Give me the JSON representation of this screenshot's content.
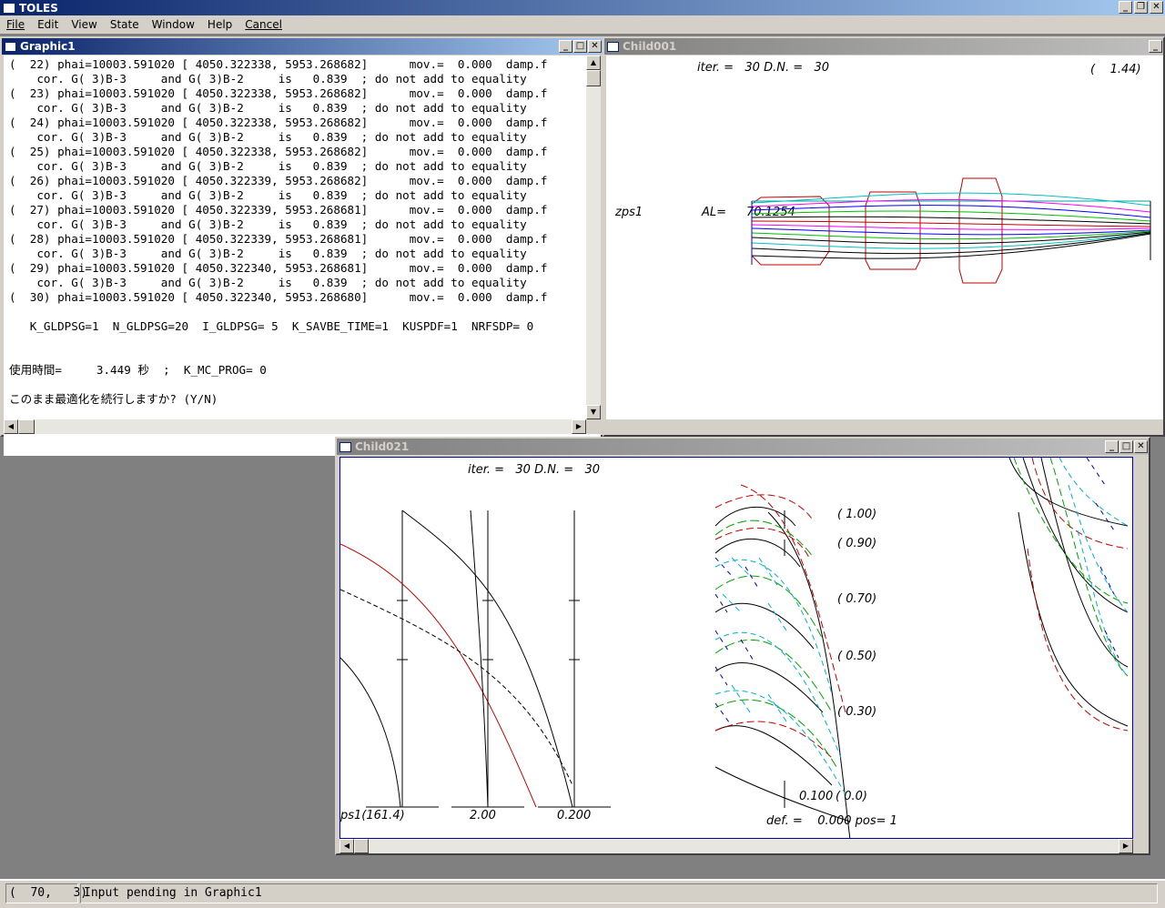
{
  "app": {
    "title": "TOLES"
  },
  "menu": {
    "file": "File",
    "edit": "Edit",
    "view": "View",
    "state": "State",
    "window": "Window",
    "help": "Help",
    "cancel": "Cancel"
  },
  "graphic1": {
    "title": "Graphic1",
    "lines": [
      "(  22) phai=10003.591020 [ 4050.322338, 5953.268682]      mov.=  0.000  damp.f",
      "    cor. G( 3)B-3     and G( 3)B-2     is   0.839  ; do not add to equality",
      "(  23) phai=10003.591020 [ 4050.322338, 5953.268682]      mov.=  0.000  damp.f",
      "    cor. G( 3)B-3     and G( 3)B-2     is   0.839  ; do not add to equality",
      "(  24) phai=10003.591020 [ 4050.322338, 5953.268682]      mov.=  0.000  damp.f",
      "    cor. G( 3)B-3     and G( 3)B-2     is   0.839  ; do not add to equality",
      "(  25) phai=10003.591020 [ 4050.322338, 5953.268682]      mov.=  0.000  damp.f",
      "    cor. G( 3)B-3     and G( 3)B-2     is   0.839  ; do not add to equality",
      "(  26) phai=10003.591020 [ 4050.322339, 5953.268682]      mov.=  0.000  damp.f",
      "    cor. G( 3)B-3     and G( 3)B-2     is   0.839  ; do not add to equality",
      "(  27) phai=10003.591020 [ 4050.322339, 5953.268681]      mov.=  0.000  damp.f",
      "    cor. G( 3)B-3     and G( 3)B-2     is   0.839  ; do not add to equality",
      "(  28) phai=10003.591020 [ 4050.322339, 5953.268681]      mov.=  0.000  damp.f",
      "    cor. G( 3)B-3     and G( 3)B-2     is   0.839  ; do not add to equality",
      "(  29) phai=10003.591020 [ 4050.322340, 5953.268681]      mov.=  0.000  damp.f",
      "    cor. G( 3)B-3     and G( 3)B-2     is   0.839  ; do not add to equality",
      "(  30) phai=10003.591020 [ 4050.322340, 5953.268680]      mov.=  0.000  damp.f",
      "",
      "   K_GLDPSG=1  N_GLDPSG=20  I_GLDPSG= 5  K_SAVBE_TIME=1  KUSPDF=1  NRFSDP= 0",
      "",
      "",
      "使用時間=     3.449 秒  ;  K_MC_PROG= 0",
      "",
      "このまま最適化を続行しますか? (Y/N)"
    ]
  },
  "child001": {
    "title": "Child001",
    "iter_label": "iter. =   30 D.N. =   30",
    "field_value": "(    1.44)",
    "zps_label": "zps1",
    "al_label": "AL=",
    "al_value": "70.1254"
  },
  "child021": {
    "title": "Child021",
    "iter_label": "iter. =   30 D.N. =   30",
    "axis_labels": [
      "ps1(161.4)",
      "2.00",
      "0.200"
    ],
    "field_labels": [
      "( 1.00)",
      "( 0.90)",
      "( 0.70)",
      "( 0.50)",
      "( 0.30)",
      "( 0.0)"
    ],
    "small_value": "0.100",
    "def_label": "def. =    0.000 pos= 1"
  },
  "status": {
    "position": "(  70,   3)",
    "message": "Input pending in Graphic1"
  }
}
